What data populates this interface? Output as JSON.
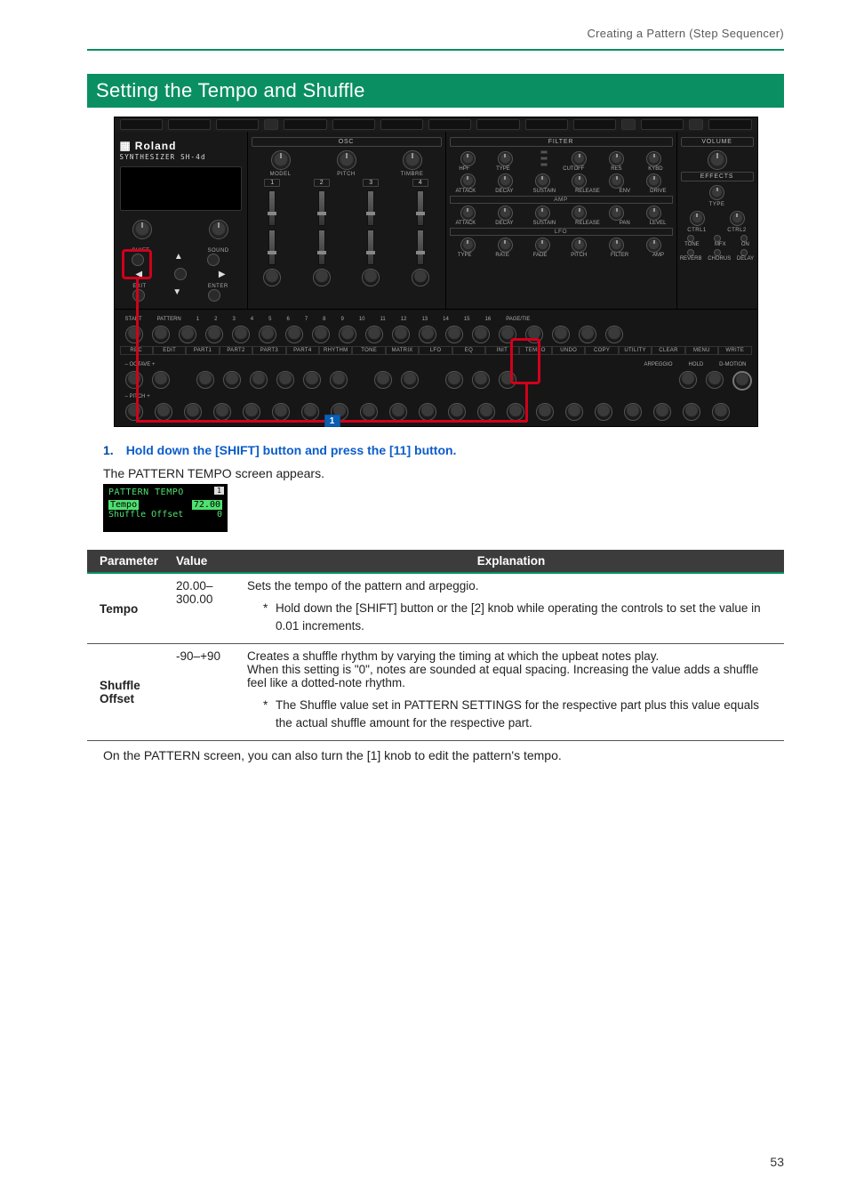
{
  "breadcrumb": "Creating a Pattern (Step Sequencer)",
  "section_title": "Setting the Tempo and Shuffle",
  "synth": {
    "brand": "Roland",
    "subtitle": "SYNTHESIZER SH-4d",
    "osc_label": "OSC",
    "osc_knobs": [
      "MODEL",
      "PITCH",
      "TIMBRE"
    ],
    "osc_nums": [
      "1",
      "2",
      "3",
      "4"
    ],
    "filter_label": "FILTER",
    "filter_top": [
      "HPF",
      "TYPE",
      "CUTOFF",
      "RES",
      "KYBD"
    ],
    "env_lbls": [
      "ATTACK",
      "DECAY",
      "SUSTAIN",
      "RELEASE",
      "ENV",
      "DRIVE"
    ],
    "amp_label": "AMP",
    "amp_lbls": [
      "ATTACK",
      "DECAY",
      "SUSTAIN",
      "RELEASE",
      "PAN",
      "LEVEL"
    ],
    "lfo_label": "LFO",
    "lfo_lbls": [
      "TYPE",
      "RATE",
      "FADE",
      "PITCH",
      "FILTER",
      "AMP"
    ],
    "volume_label": "VOLUME",
    "effects_label": "EFFECTS",
    "fx_sub1": "TYPE",
    "fx_ctrls": [
      "CTRL1",
      "CTRL2"
    ],
    "fx_tone": "TONE",
    "fx_mfx": "MFX",
    "fx_on": "ON",
    "fx_bottom": [
      "REVERB",
      "CHORUS",
      "DELAY"
    ],
    "dir": {
      "shift": "SHIFT",
      "sound": "SOUND",
      "exit": "EXIT",
      "enter": "ENTER"
    },
    "steps_top": [
      "START",
      "PATTERN",
      "1",
      "2",
      "3",
      "4",
      "5",
      "6",
      "7",
      "8",
      "9",
      "10",
      "11",
      "12",
      "13",
      "14",
      "15",
      "16",
      "PAGE/TIE"
    ],
    "funcs": [
      "REC",
      "EDIT",
      "PART1",
      "PART2",
      "PART3",
      "PART4",
      "RHYTHM",
      "TONE",
      "MATRIX",
      "LFO",
      "EQ",
      "INIT",
      "TEMPO",
      "UNDO",
      "COPY",
      "UTILITY",
      "CLEAR",
      "MENU",
      "WRITE"
    ],
    "octave": "OCTAVE",
    "pitch": "PITCH",
    "arp_lbls": [
      "ARPEGGIO",
      "HOLD",
      "D-MOTION"
    ]
  },
  "badge": "1",
  "step1": {
    "num": "1.",
    "text": "Hold down the [SHIFT] button and press the [11] button."
  },
  "appears": "The PATTERN TEMPO screen appears.",
  "lcd": {
    "title": "PATTERN TEMPO",
    "page": "1",
    "param": "Tempo",
    "value": "72.00",
    "p2": "Shuffle Offset",
    "v2": "0"
  },
  "table": {
    "headers": [
      "Parameter",
      "Value",
      "Explanation"
    ],
    "rows": [
      {
        "param": "Tempo",
        "value": "20.00–300.00",
        "exp_main": "Sets the tempo of the pattern and arpeggio.",
        "bullets": [
          "Hold down the [SHIFT] button or the [2] knob while operating the controls to set the value in 0.01 increments."
        ]
      },
      {
        "param": "Shuffle Offset",
        "value": "-90–+90",
        "exp_main": "Creates a shuffle rhythm by varying the timing at which the upbeat notes play.",
        "exp_extra": "When this setting is \"0\", notes are sounded at equal spacing. Increasing the value adds a shuffle feel like a dotted-note rhythm.",
        "bullets": [
          "The Shuffle value set in PATTERN SETTINGS for the respective part plus this value equals the actual shuffle amount for the respective part."
        ]
      }
    ]
  },
  "footnote": "On the PATTERN screen, you can also turn the [1] knob to edit the pattern's tempo.",
  "page_number": "53"
}
